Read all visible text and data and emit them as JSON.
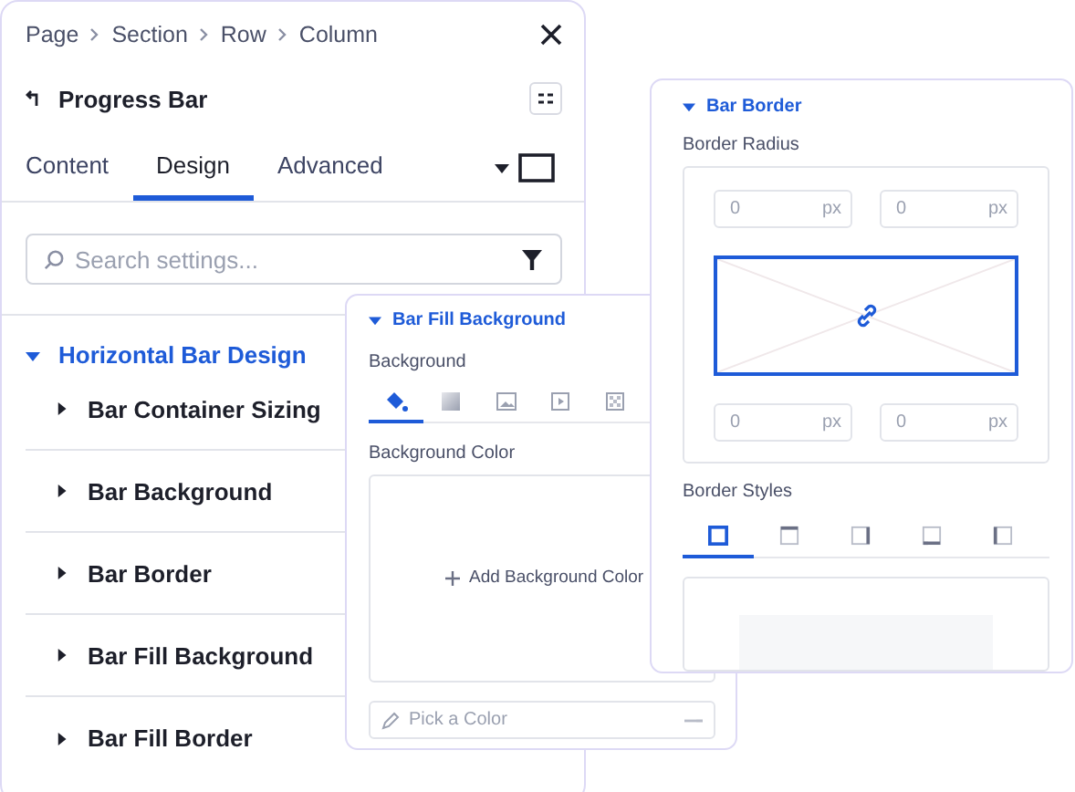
{
  "breadcrumb": [
    "Page",
    "Section",
    "Row",
    "Column"
  ],
  "element_title": "Progress Bar",
  "tabs": [
    {
      "label": "Content",
      "selected": false
    },
    {
      "label": "Design",
      "selected": true
    },
    {
      "label": "Advanced",
      "selected": false
    }
  ],
  "search": {
    "placeholder": "Search settings..."
  },
  "group": {
    "title": "Horizontal Bar Design",
    "expanded": true,
    "items": [
      {
        "label": "Bar Container Sizing",
        "expanded": false
      },
      {
        "label": "Bar Background",
        "expanded": false
      },
      {
        "label": "Bar Border",
        "expanded": false
      },
      {
        "label": "Bar Fill Background",
        "expanded": false
      },
      {
        "label": "Bar Fill Border",
        "expanded": false
      }
    ]
  },
  "fill_panel": {
    "title": "Bar Fill Background",
    "expanded": true,
    "background_label": "Background",
    "type_tabs": [
      {
        "kind": "color",
        "selected": true
      },
      {
        "kind": "gradient",
        "selected": false
      },
      {
        "kind": "image",
        "selected": false
      },
      {
        "kind": "video",
        "selected": false
      },
      {
        "kind": "pattern",
        "selected": false
      }
    ],
    "color_label": "Background Color",
    "add_label": "Add Background Color",
    "color_field": {
      "placeholder": "Pick a Color"
    }
  },
  "border_panel": {
    "title": "Bar Border",
    "expanded": true,
    "radius_label": "Border Radius",
    "radius_inputs": [
      {
        "placeholder": "0",
        "unit": "px"
      },
      {
        "placeholder": "0",
        "unit": "px"
      },
      {
        "placeholder": "0",
        "unit": "px"
      },
      {
        "placeholder": "0",
        "unit": "px"
      }
    ],
    "linked": true,
    "styles_label": "Border Styles",
    "style_tabs": [
      {
        "kind": "all",
        "selected": true
      },
      {
        "kind": "top",
        "selected": false
      },
      {
        "kind": "right",
        "selected": false
      },
      {
        "kind": "bottom",
        "selected": false
      },
      {
        "kind": "left",
        "selected": false
      }
    ]
  }
}
